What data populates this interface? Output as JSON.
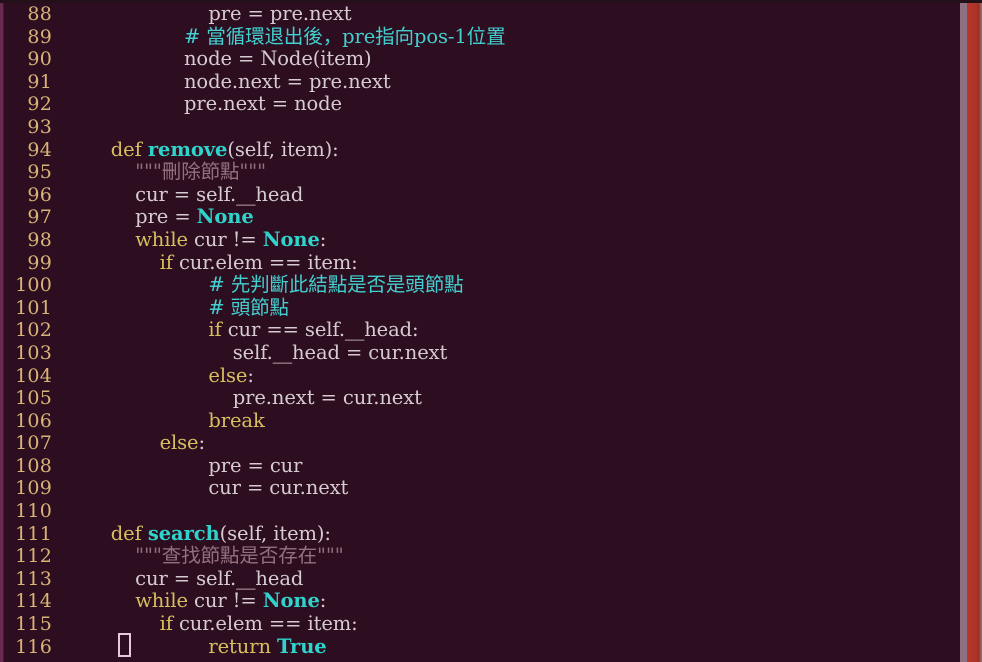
{
  "window": {
    "kind": "code-editor",
    "background_color": "#2d0e20",
    "gutter_color": "#d9b477",
    "text_color": "#cfc4cc"
  },
  "colors": {
    "background": "#2d0e20",
    "line_number": "#d9b477",
    "keyword": "#d8bf5e",
    "function_name": "#2fd3cb",
    "constant": "#2fd3cb",
    "comment": "#43cfd0",
    "docstring": "#94707f",
    "plain_text": "#d6cbd3",
    "left_edge": "#7a3060",
    "scrollbar": "#8d7183",
    "accent_band": "#b8372c",
    "cursor_outline": "#e8c8dc"
  },
  "cursor": {
    "line": 116,
    "shape": "hollow-block"
  },
  "code": {
    "first_line_number": 88,
    "last_line_number": 116,
    "lines": [
      {
        "n": "88",
        "tokens": [
          {
            "t": "plain",
            "s": "                        pre = pre.next"
          }
        ]
      },
      {
        "n": "89",
        "tokens": [
          {
            "t": "comment",
            "s": "                    # 當循環退出後，pre指向pos-1位置"
          }
        ]
      },
      {
        "n": "90",
        "tokens": [
          {
            "t": "plain",
            "s": "                    node = Node(item)"
          }
        ]
      },
      {
        "n": "91",
        "tokens": [
          {
            "t": "plain",
            "s": "                    node.next = pre.next"
          }
        ]
      },
      {
        "n": "92",
        "tokens": [
          {
            "t": "plain",
            "s": "                    pre.next = node"
          }
        ]
      },
      {
        "n": "93",
        "tokens": [
          {
            "t": "plain",
            "s": ""
          }
        ]
      },
      {
        "n": "94",
        "tokens": [
          {
            "t": "plain",
            "s": "        "
          },
          {
            "t": "keyword",
            "s": "def"
          },
          {
            "t": "plain",
            "s": " "
          },
          {
            "t": "function",
            "s": "remove"
          },
          {
            "t": "plain",
            "s": "(self, item):"
          }
        ]
      },
      {
        "n": "95",
        "tokens": [
          {
            "t": "docstring",
            "s": "            \"\"\"刪除節點\"\"\""
          }
        ]
      },
      {
        "n": "96",
        "tokens": [
          {
            "t": "plain",
            "s": "            cur = self.__head"
          }
        ]
      },
      {
        "n": "97",
        "tokens": [
          {
            "t": "plain",
            "s": "            pre = "
          },
          {
            "t": "constant",
            "s": "None"
          }
        ]
      },
      {
        "n": "98",
        "tokens": [
          {
            "t": "plain",
            "s": "            "
          },
          {
            "t": "keyword",
            "s": "while"
          },
          {
            "t": "plain",
            "s": " cur != "
          },
          {
            "t": "constant",
            "s": "None"
          },
          {
            "t": "plain",
            "s": ":"
          }
        ]
      },
      {
        "n": "99",
        "tokens": [
          {
            "t": "plain",
            "s": "                "
          },
          {
            "t": "keyword",
            "s": "if"
          },
          {
            "t": "plain",
            "s": " cur.elem == item:"
          }
        ]
      },
      {
        "n": "100",
        "tokens": [
          {
            "t": "comment",
            "s": "                        # 先判斷此結點是否是頭節點"
          }
        ]
      },
      {
        "n": "101",
        "tokens": [
          {
            "t": "comment",
            "s": "                        # 頭節點"
          }
        ]
      },
      {
        "n": "102",
        "tokens": [
          {
            "t": "plain",
            "s": "                        "
          },
          {
            "t": "keyword",
            "s": "if"
          },
          {
            "t": "plain",
            "s": " cur == self.__head:"
          }
        ]
      },
      {
        "n": "103",
        "tokens": [
          {
            "t": "plain",
            "s": "                            self.__head = cur.next"
          }
        ]
      },
      {
        "n": "104",
        "tokens": [
          {
            "t": "plain",
            "s": "                        "
          },
          {
            "t": "keyword",
            "s": "else"
          },
          {
            "t": "plain",
            "s": ":"
          }
        ]
      },
      {
        "n": "105",
        "tokens": [
          {
            "t": "plain",
            "s": "                            pre.next = cur.next"
          }
        ]
      },
      {
        "n": "106",
        "tokens": [
          {
            "t": "plain",
            "s": "                        "
          },
          {
            "t": "keyword",
            "s": "break"
          }
        ]
      },
      {
        "n": "107",
        "tokens": [
          {
            "t": "plain",
            "s": "                "
          },
          {
            "t": "keyword",
            "s": "else"
          },
          {
            "t": "plain",
            "s": ":"
          }
        ]
      },
      {
        "n": "108",
        "tokens": [
          {
            "t": "plain",
            "s": "                        pre = cur"
          }
        ]
      },
      {
        "n": "109",
        "tokens": [
          {
            "t": "plain",
            "s": "                        cur = cur.next"
          }
        ]
      },
      {
        "n": "110",
        "tokens": [
          {
            "t": "plain",
            "s": ""
          }
        ]
      },
      {
        "n": "111",
        "tokens": [
          {
            "t": "plain",
            "s": "        "
          },
          {
            "t": "keyword",
            "s": "def"
          },
          {
            "t": "plain",
            "s": " "
          },
          {
            "t": "function",
            "s": "search"
          },
          {
            "t": "plain",
            "s": "(self, item):"
          }
        ]
      },
      {
        "n": "112",
        "tokens": [
          {
            "t": "docstring",
            "s": "            \"\"\"查找節點是否存在\"\"\""
          }
        ]
      },
      {
        "n": "113",
        "tokens": [
          {
            "t": "plain",
            "s": "            cur = self.__head"
          }
        ]
      },
      {
        "n": "114",
        "tokens": [
          {
            "t": "plain",
            "s": "            "
          },
          {
            "t": "keyword",
            "s": "while"
          },
          {
            "t": "plain",
            "s": " cur != "
          },
          {
            "t": "constant",
            "s": "None"
          },
          {
            "t": "plain",
            "s": ":"
          }
        ]
      },
      {
        "n": "115",
        "tokens": [
          {
            "t": "plain",
            "s": "                "
          },
          {
            "t": "keyword",
            "s": "if"
          },
          {
            "t": "plain",
            "s": " cur.elem == item:"
          }
        ]
      },
      {
        "n": "116",
        "tokens": [
          {
            "t": "plain",
            "s": "                        "
          },
          {
            "t": "keyword",
            "s": "return"
          },
          {
            "t": "plain",
            "s": " "
          },
          {
            "t": "constant",
            "s": "True"
          }
        ]
      }
    ]
  }
}
